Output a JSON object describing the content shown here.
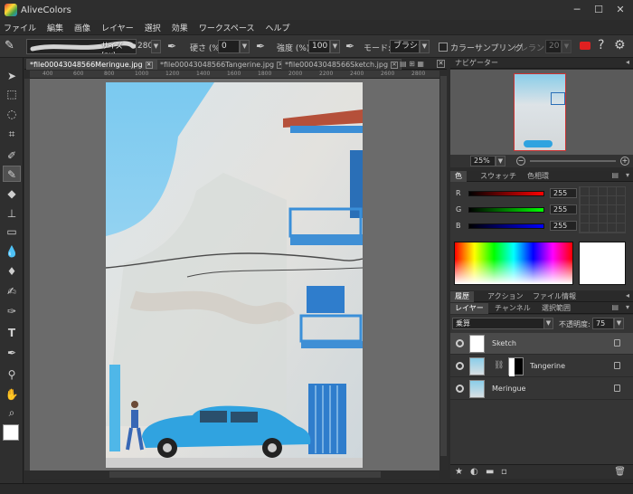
{
  "window": {
    "title": "AliveColors"
  },
  "menu": [
    "ファイル",
    "編集",
    "画像",
    "レイヤー",
    "選択",
    "効果",
    "ワークスペース",
    "ヘルプ"
  ],
  "options": {
    "brush_size_label": "サイズ (px)",
    "brush_size": "280",
    "hardness_label": "硬さ (%)",
    "hardness": "0",
    "strength_label": "強度 (%)",
    "strength": "100",
    "mode_label": "モード:",
    "mode": "ブラシモ",
    "color_sampling_label": "カラーサンプリング",
    "tolerance_label": "トレランス",
    "tolerance": "20"
  },
  "documents": {
    "tabs": [
      {
        "label": "*file0004304856​6Meringue.jpg",
        "active": true
      },
      {
        "label": "*file0004304856​6Tangerine.jpg",
        "active": false
      },
      {
        "label": "*file0004304856​6Sketch.jpg",
        "active": false
      }
    ],
    "ruler_ticks": [
      "400",
      "600",
      "800",
      "1000",
      "1200",
      "1400",
      "1600",
      "1800",
      "2000",
      "2200",
      "2400",
      "2600",
      "2800"
    ]
  },
  "navigator": {
    "title": "ナビゲーター",
    "zoom": "25%"
  },
  "color_panel": {
    "tabs": [
      "色",
      "スウォッチ",
      "色相環"
    ],
    "r_label": "R",
    "r": "255",
    "g_label": "G",
    "g": "255",
    "b_label": "B",
    "b": "255",
    "current_color": "#ffffff"
  },
  "info_tabs": [
    "履歴",
    "アクション",
    "ファイル情報"
  ],
  "layers_panel": {
    "tabs": [
      "レイヤー",
      "チャンネル",
      "選択範囲"
    ],
    "blend_mode": "乗算",
    "opacity_label": "不透明度:",
    "opacity": "75",
    "layers": [
      {
        "name": "Sketch",
        "selected": true
      },
      {
        "name": "Tangerine",
        "selected": false
      },
      {
        "name": "Meringue",
        "selected": false
      }
    ]
  },
  "colors": {
    "accent_red": "#e02020",
    "panel_bg": "#353535"
  }
}
